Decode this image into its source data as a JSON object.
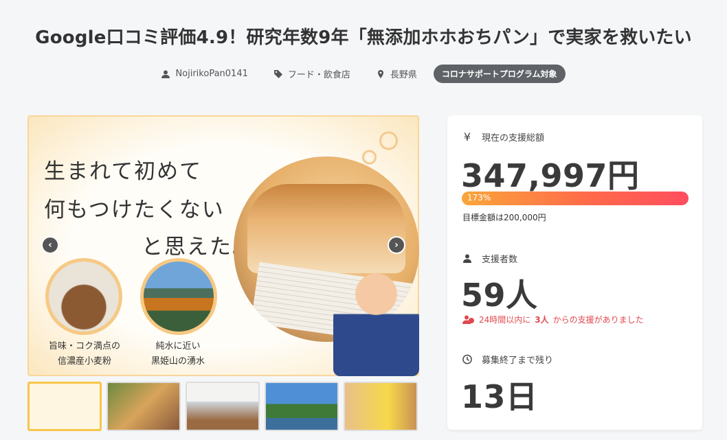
{
  "project": {
    "title": "Google口コミ評価4.9！研究年数9年「無添加ホホおちパン」で実家を救いたい",
    "owner": "NojirikoPan0141",
    "category": "フード・飲食店",
    "location": "長野県",
    "badge": "コロナサポートプログラム対象"
  },
  "gallery": {
    "slide_text": {
      "line1": "生まれて初めて",
      "line2": "何もつけたくない",
      "line3": "と思えた。"
    },
    "captions": [
      {
        "line1": "旨味・コク満点の",
        "line2": "信濃産小麦粉"
      },
      {
        "line1": "純水に近い",
        "line2": "黒姫山の湧水"
      }
    ],
    "prev_icon": "chevron-left-icon",
    "next_icon": "chevron-right-icon",
    "thumbnails": [
      {
        "name": "thumb-1",
        "active": true
      },
      {
        "name": "thumb-2",
        "active": false
      },
      {
        "name": "thumb-3",
        "active": false
      },
      {
        "name": "thumb-4",
        "active": false
      },
      {
        "name": "thumb-5",
        "active": false
      }
    ]
  },
  "stats": {
    "total_label": "現在の支援総額",
    "total_amount": "347,997円",
    "progress_percent": 173,
    "progress_label": "173%",
    "goal_text": "目標金額は200,000円",
    "supporters_label": "支援者数",
    "supporters_count": "59人",
    "recent_prefix": "24時間以内に",
    "recent_count": "3人",
    "recent_suffix": "からの支援がありました",
    "remaining_label": "募集終了まで残り",
    "remaining_days": "13日"
  },
  "colors": {
    "badge_bg": "#5f6368",
    "progress_start": "#f9a63a",
    "progress_end": "#ff4d5e",
    "recent_text": "#e0484e",
    "active_thumb_border": "#f6c64a"
  }
}
